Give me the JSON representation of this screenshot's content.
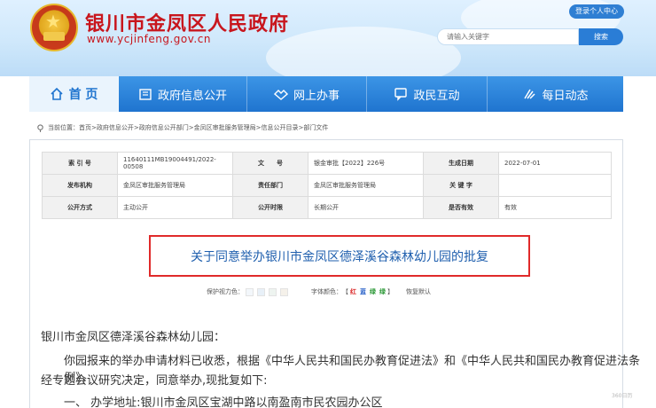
{
  "header": {
    "site_title": "银川市金凤区人民政府",
    "site_url": "www.ycjinfeng.gov.cn",
    "login_link": "登录个人中心",
    "search_placeholder": "请输入关键字",
    "search_button": "搜索"
  },
  "nav": {
    "items": [
      {
        "label": "首  页",
        "icon": "home-icon"
      },
      {
        "label": "政府信息公开",
        "icon": "building-icon"
      },
      {
        "label": "网上办事",
        "icon": "handshake-icon"
      },
      {
        "label": "政民互动",
        "icon": "chat-icon"
      },
      {
        "label": "每日动态",
        "icon": "broadcast-icon"
      }
    ]
  },
  "breadcrumb": {
    "text": "当前位置：首页>政府信息公开>政府信息公开部门>金凤区审批服务管理局>信息公开目录>部门文件"
  },
  "meta": {
    "index_label": "索 引 号",
    "index_value": "11640111MB19004491/2022-00508",
    "docno_label": "文　　号",
    "docno_value": "银金审批【2022】226号",
    "date_label": "生成日期",
    "date_value": "2022-07-01",
    "issuer_label": "发布机构",
    "issuer_value": "金凤区审批服务管理局",
    "dept_label": "责任部门",
    "dept_value": "金凤区审批服务管理局",
    "keyword_label": "关 键 字",
    "keyword_value": "",
    "mode_label": "公开方式",
    "mode_value": "主动公开",
    "period_label": "公开时限",
    "period_value": "长期公开",
    "valid_label": "是否有效",
    "valid_value": "有效"
  },
  "document": {
    "title": "关于同意举办银川市金凤区德泽溪谷森林幼儿园的批复",
    "salutation": "银川市金凤区德泽溪谷森林幼儿园：",
    "paragraph1_line1": "你园报来的举办申请材料已收悉，根据《中华人民共和国民办教育促进法》和《中华人民共和国民办教育促进法条例》，",
    "paragraph1_line2": "经专题会议研究决定，同意举办,现批复如下:",
    "item1": "一、 办学地址:银川市金凤区宝湖中路以南盈南市民农园办公区"
  },
  "tools": {
    "eye_label": "保护视力色：",
    "font_label": "字体颜色：",
    "bracket_open": "【",
    "bracket_close": "】",
    "color_red": "红",
    "color_blue": "蓝",
    "color_green": "绿",
    "color_black": "绿",
    "reset": "恢复默认"
  },
  "colors": {
    "brand_red": "#c8161d",
    "nav_blue": "#1f74cf",
    "title_border": "#e02a2a",
    "title_text": "#1f5fae"
  },
  "watermark": "360日历"
}
